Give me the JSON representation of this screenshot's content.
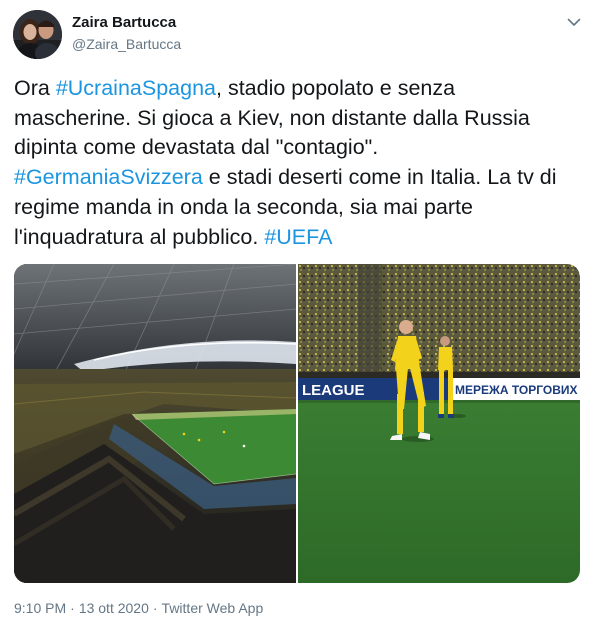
{
  "author": {
    "display_name": "Zaira Bartucca",
    "handle": "@Zaira_Bartucca"
  },
  "tweet": {
    "lines": [
      [
        {
          "text": "Ora "
        },
        {
          "text": "#UcrainaSpagna",
          "hashtag": true
        },
        {
          "text": ", stadio popolato e senza"
        }
      ],
      [
        {
          "text": "mascherine. Si gioca a Kiev, non distante dalla Russia"
        }
      ],
      [
        {
          "text": "dipinta come devastata dal \"contagio\"."
        }
      ],
      [
        {
          "text": "#GermaniaSvizzera",
          "hashtag": true
        },
        {
          "text": " e stadi deserti come in Italia. La tv di"
        }
      ],
      [
        {
          "text": "regime manda in onda la seconda, sia mai parte"
        }
      ],
      [
        {
          "text": "l'inquadratura al pubblico. "
        },
        {
          "text": "#UEFA",
          "hashtag": true
        }
      ]
    ]
  },
  "media": {
    "banner_left": "LEAGUE",
    "banner_right": "МЕРЕЖА ТОРГОВИХ"
  },
  "meta": {
    "time": "9:10 PM",
    "separator": "·",
    "date": "13 ott 2020",
    "source": "Twitter Web App"
  },
  "colors": {
    "link": "#1b95e0",
    "text": "#14171a",
    "secondary": "#657786",
    "pitch": "#2f7a2c",
    "kit": "#f2d21a",
    "banner": "#1a3a7a"
  },
  "icons": {
    "caret": "chevron-down-icon"
  }
}
